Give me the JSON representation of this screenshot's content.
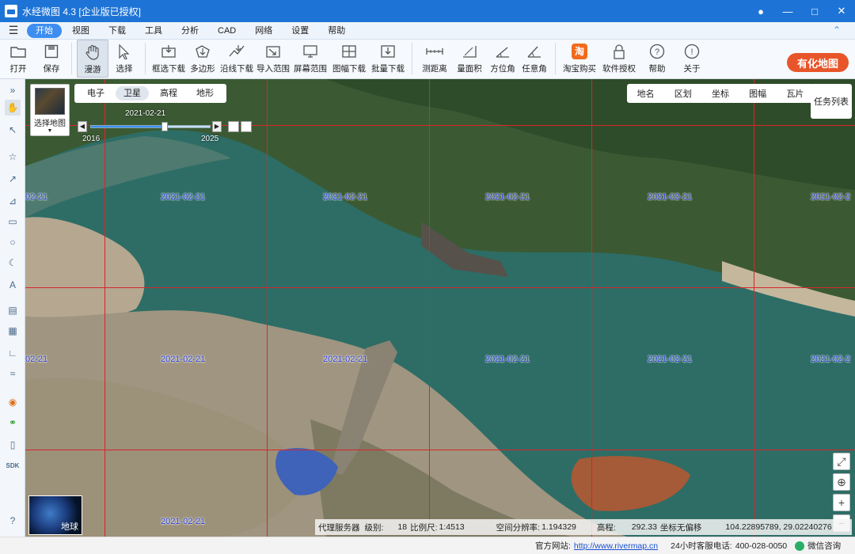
{
  "window": {
    "title": "水经微图 4.3 [企业版已授权]"
  },
  "menu": {
    "items": [
      "开始",
      "视图",
      "下载",
      "工具",
      "分析",
      "CAD",
      "网络",
      "设置",
      "帮助"
    ],
    "active": "开始"
  },
  "toolbar": {
    "open": "打开",
    "save": "保存",
    "pan": "漫游",
    "select": "选择",
    "rect_download": "框选下载",
    "polygon": "多边形",
    "line_download": "沿线下载",
    "import_range": "导入范围",
    "screen_range": "屏幕范围",
    "sheet_download": "图幅下载",
    "batch_download": "批量下载",
    "measure_distance": "测距离",
    "measure_area": "量面积",
    "azimuth": "方位角",
    "any_angle": "任意角",
    "taobao": "淘宝购买",
    "license": "软件授权",
    "help": "帮助",
    "about": "关于"
  },
  "brand": {
    "text": "有化地图"
  },
  "map": {
    "layer_selector": "选择地图",
    "types": [
      "电子",
      "卫星",
      "高程",
      "地形"
    ],
    "active_type": "卫星",
    "timeline": {
      "current": "2021-02-21",
      "start": "2016",
      "end": "2025",
      "position": 0.62
    },
    "overlays": [
      "地名",
      "区划",
      "坐标",
      "图幅",
      "瓦片"
    ],
    "tasks": "任务列表",
    "globe": "地球",
    "tile_date": "2021-02-21",
    "partial_date": "02-21",
    "partial_date_right": "2021-02-2"
  },
  "status": {
    "proxy": "代理服务器",
    "level_label": "级别:",
    "level": "18",
    "scale_label": "比例尺:",
    "scale": "1:4513",
    "resolution_label": "空间分辨率:",
    "resolution": "1.194329",
    "elevation_label": "高程:",
    "elevation": "292.33",
    "coord_label": "坐标无偏移",
    "coords": "104.22895789, 29.02240276"
  },
  "footer": {
    "site_label": "官方网站:",
    "site_url": "http://www.rivermap.cn",
    "phone_label": "24小时客服电话:",
    "phone": "400-028-0050",
    "wechat": "微信咨询"
  }
}
